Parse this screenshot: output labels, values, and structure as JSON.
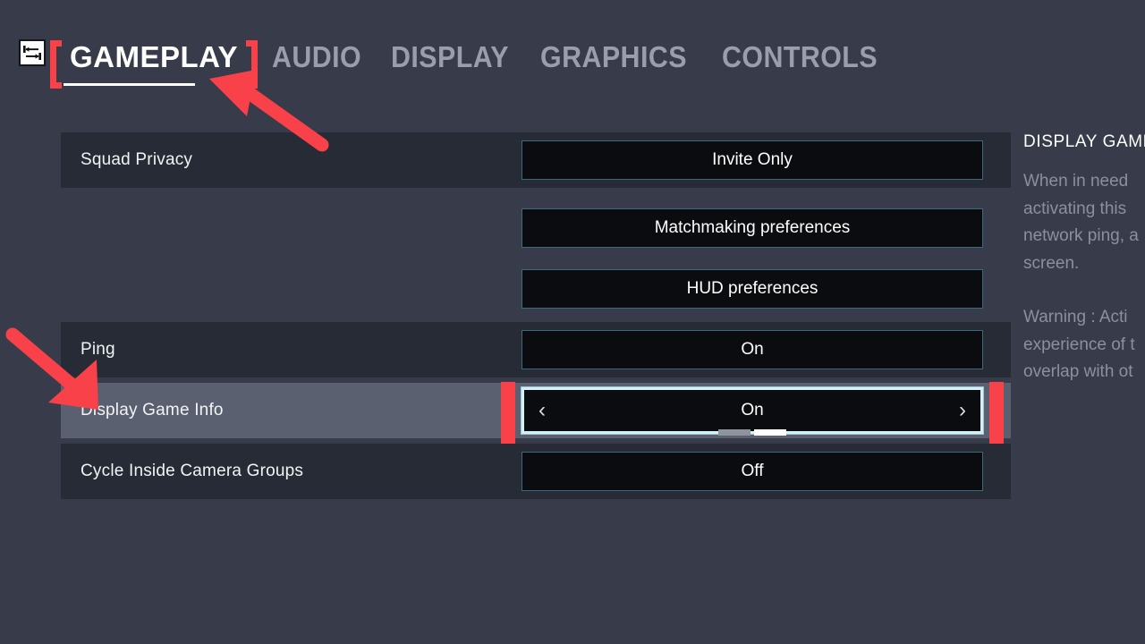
{
  "nav": {
    "icon": "settings-sliders-icon",
    "tabs": [
      {
        "id": "gameplay",
        "label": "GAMEPLAY",
        "active": true
      },
      {
        "id": "audio",
        "label": "AUDIO",
        "active": false
      },
      {
        "id": "display",
        "label": "DISPLAY",
        "active": false
      },
      {
        "id": "graphics",
        "label": "GRAPHICS",
        "active": false
      },
      {
        "id": "controls",
        "label": "CONTROLS",
        "active": false
      }
    ]
  },
  "settings": {
    "rows": [
      {
        "label": "Squad Privacy",
        "value": "Invite Only"
      },
      {
        "label": "",
        "value": "Matchmaking preferences"
      },
      {
        "label": "",
        "value": "HUD preferences"
      },
      {
        "label": "Ping",
        "value": "On"
      },
      {
        "label": "Display Game Info",
        "value": "On"
      },
      {
        "label": "Cycle Inside Camera Groups",
        "value": "Off"
      }
    ],
    "selected_row_index": 4,
    "selected_chevron_left": "‹",
    "selected_chevron_right": "›",
    "segments": [
      {
        "active": false
      },
      {
        "active": true
      }
    ]
  },
  "info": {
    "title": "DISPLAY GAME",
    "paragraph1": "When in need\nactivating this\nnetwork ping, a\nscreen.",
    "paragraph2": "Warning : Acti\nexperience of t\noverlap with ot"
  },
  "colors": {
    "page_background": "#383c4a",
    "row_background": "#262b35",
    "row_selected_background": "#5b6070",
    "control_background": "#0a0c0f",
    "control_border": "#3f6878",
    "control_selected_border": "#d6eef5",
    "accent_red": "#f9414a",
    "text_primary": "#ffffff",
    "text_muted": "#8b909c",
    "tab_inactive": "#9a9daa"
  },
  "annotations": {
    "arrow_top": "red-arrow-pointing-to-gameplay-tab",
    "arrow_left": "red-arrow-pointing-to-display-game-info-row"
  }
}
